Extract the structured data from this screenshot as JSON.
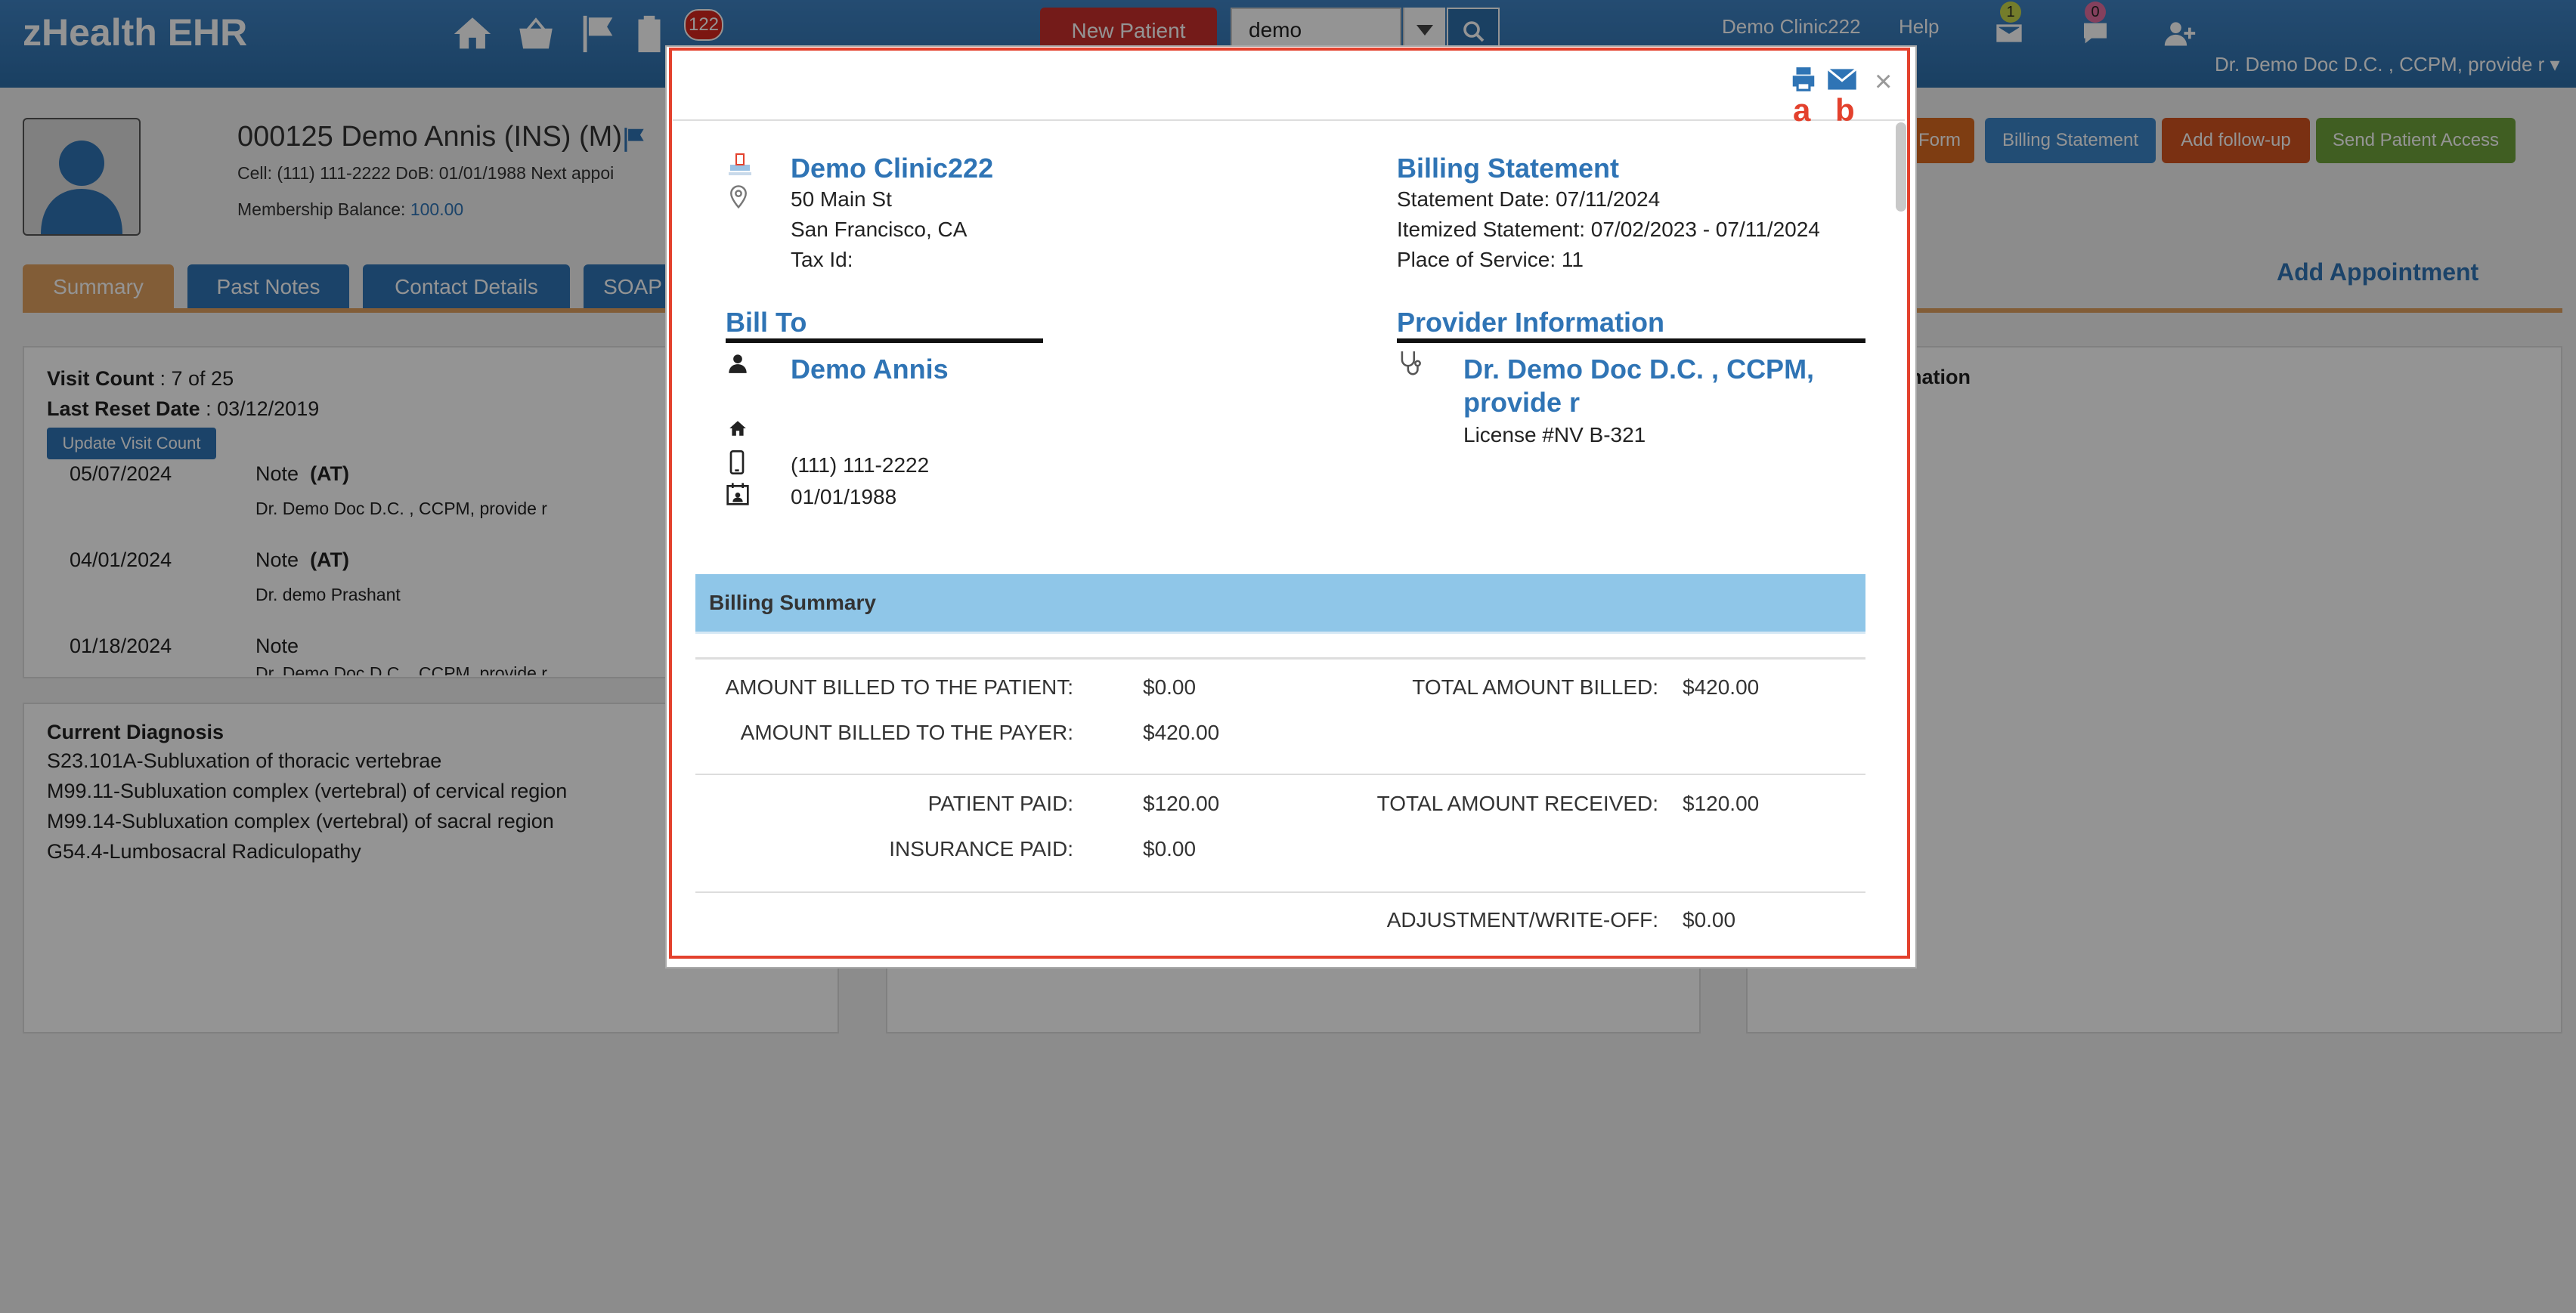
{
  "app": {
    "brand": "zHealth EHR",
    "notification_count": "122",
    "new_patient_label": "New Patient",
    "search_value": "demo",
    "clinic_link": "Demo Clinic222",
    "help_link": "Help",
    "mail_badge": "1",
    "chat_badge": "0",
    "user_menu": "Dr. Demo Doc D.C. , CCPM, provide r ▾"
  },
  "patient": {
    "name_line": "000125 Demo Annis  (INS) (M)",
    "info_line": "Cell: (111) 111-2222   DoB: 01/01/1988   Next appoi",
    "membership_label": "Membership Balance: ",
    "membership_value": "100.00"
  },
  "actions": {
    "form": "Form",
    "billing_statement": "Billing Statement",
    "add_followup": "Add follow-up",
    "send_access": "Send Patient Access",
    "add_appointment": "Add Appointment"
  },
  "tabs": [
    "Summary",
    "Past Notes",
    "Contact Details",
    "SOAP"
  ],
  "summary_panel": {
    "visit_count_label": "Visit Count",
    "visit_count_value": " : 7 of 25",
    "last_reset_label": "Last Reset Date",
    "last_reset_value": " : 03/12/2019",
    "update_btn": "Update Visit Count",
    "notes": [
      {
        "date": "05/07/2024",
        "title": "Note",
        "tag": "(AT)",
        "provider": "Dr. Demo Doc D.C. , CCPM, provide r"
      },
      {
        "date": "04/01/2024",
        "title": "Note",
        "tag": "(AT)",
        "provider": "Dr. demo Prashant"
      },
      {
        "date": "01/18/2024",
        "title": "Note",
        "tag": "",
        "provider": "Dr. Demo Doc D.C. , CCPM, provide r"
      }
    ]
  },
  "diagnosis": {
    "title": "Current Diagnosis",
    "items": [
      "S23.101A-Subluxation of thoracic vertebrae",
      "M99.11-Subluxation complex (vertebral) of cervical region",
      "M99.14-Subluxation complex (vertebral) of sacral region",
      "G54.4-Lumbosacral Radiculopathy"
    ]
  },
  "right_panel": {
    "title_fragment": "rmation"
  },
  "modal": {
    "label_a": "a",
    "label_b": "b",
    "close": "×",
    "clinic_name": "Demo Clinic222",
    "address1": "50 Main St",
    "address2": "San Francisco, CA",
    "tax_id": "Tax Id:",
    "statement_title": "Billing Statement",
    "statement_date": "Statement Date: 07/11/2024",
    "itemized": "Itemized Statement: 07/02/2023 - 07/11/2024",
    "place_of_service": "Place of Service: 11",
    "bill_to_heading": "Bill To",
    "bill_to_name": "Demo Annis",
    "phone": "(111) 111-2222",
    "dob": "01/01/1988",
    "provider_heading": "Provider Information",
    "provider_name_1": "Dr. Demo Doc D.C. , CCPM,",
    "provider_name_2": "provide r",
    "license": "License #NV B-321",
    "summary_heading": "Billing Summary",
    "rows": {
      "billed_patient_label": "AMOUNT BILLED TO THE PATIENT:",
      "billed_patient_value": "$0.00",
      "total_billed_label": "TOTAL AMOUNT BILLED:",
      "total_billed_value": "$420.00",
      "billed_payer_label": "AMOUNT BILLED TO THE PAYER:",
      "billed_payer_value": "$420.00",
      "patient_paid_label": "PATIENT PAID:",
      "patient_paid_value": "$120.00",
      "total_received_label": "TOTAL AMOUNT RECEIVED:",
      "total_received_value": "$120.00",
      "insurance_paid_label": "INSURANCE PAID:",
      "insurance_paid_value": "$0.00",
      "adjustment_label": "ADJUSTMENT/WRITE-OFF:",
      "adjustment_value": "$0.00"
    }
  },
  "colors": {
    "nav": "#2d6ea9",
    "accent_red": "#e3412d",
    "summary_bar": "#8fc6e8",
    "link_blue": "#2f74b5"
  }
}
